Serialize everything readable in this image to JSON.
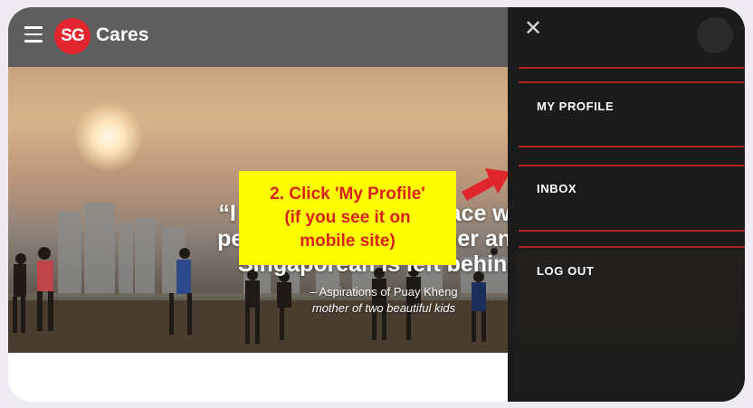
{
  "header": {
    "logo_initials": "SG",
    "logo_text": "Cares"
  },
  "hero": {
    "quote_line1": "“I hope we live in a place where",
    "quote_line2": "people help one another and no",
    "quote_line3": "Singaporean is left behind.”",
    "attribution": "– Aspirations of Puay Kheng",
    "attribution_sub": "mother of two beautiful kids"
  },
  "annotation": {
    "line1": "2. Click 'My Profile'",
    "line2": "(if you see it on",
    "line3": "mobile site)"
  },
  "drawer": {
    "close_label": "✕",
    "items": [
      {
        "label": "MY PROFILE"
      },
      {
        "label": "INBOX"
      },
      {
        "label": "LOG OUT"
      }
    ]
  },
  "colors": {
    "brand_red": "#e2252f",
    "topbar": "#5e5e5e",
    "drawer_bg": "#1b1b1b",
    "divider": "#b32226",
    "callout_bg": "#ffff00",
    "callout_text": "#d9221c"
  }
}
